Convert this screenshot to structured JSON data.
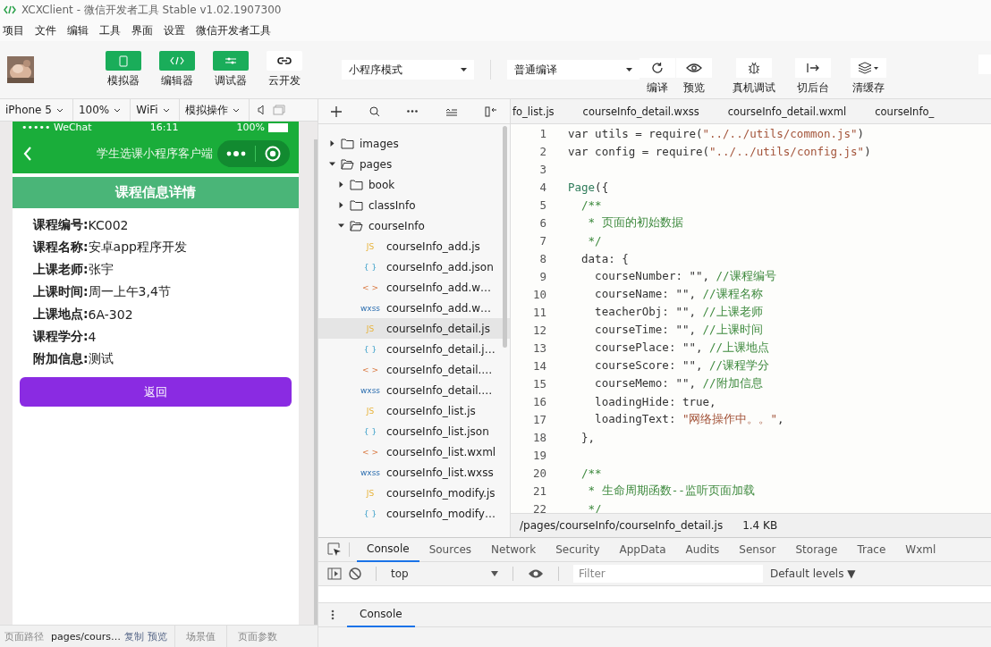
{
  "window": {
    "title": "XCXClient - 微信开发者工具 Stable v1.02.1907300"
  },
  "menu": [
    "项目",
    "文件",
    "编辑",
    "工具",
    "界面",
    "设置",
    "微信开发者工具"
  ],
  "toolbar": {
    "mode_buttons": [
      {
        "label": "模拟器",
        "on": true
      },
      {
        "label": "编辑器",
        "on": true
      },
      {
        "label": "调试器",
        "on": true
      },
      {
        "label": "云开发",
        "on": false
      }
    ],
    "mode_select": "小程序模式",
    "compile_select": "普通编译",
    "actions": [
      "编译",
      "预览",
      "真机调试",
      "切后台",
      "清缓存"
    ]
  },
  "simulator": {
    "device_bar": [
      "iPhone 5",
      "100%",
      "WiFi",
      "模拟操作"
    ],
    "status": {
      "carrier": "••••• WeChat",
      "time": "16:11",
      "battery": "100%"
    },
    "nav_title": "学生选课小程序客户端",
    "header": "课程信息详情",
    "fields": [
      {
        "label": "课程编号:",
        "value": "KC002"
      },
      {
        "label": "课程名称:",
        "value": "安卓app程序开发"
      },
      {
        "label": "上课老师:",
        "value": "张宇"
      },
      {
        "label": "上课时间:",
        "value": "周一上午3,4节"
      },
      {
        "label": "上课地点:",
        "value": "6A-302"
      },
      {
        "label": "课程学分:",
        "value": "4"
      },
      {
        "label": "附加信息:",
        "value": "测试"
      }
    ],
    "button": "返回"
  },
  "bottom_bar": {
    "label": "页面路径",
    "path": "pages/cours…",
    "links": [
      "复制",
      "预览"
    ],
    "scene": "场景值",
    "params": "页面参数"
  },
  "file_tree": [
    {
      "name": "images",
      "kind": "folder",
      "expanded": false,
      "selected": false
    },
    {
      "name": "pages",
      "kind": "folder",
      "expanded": true,
      "selected": false,
      "children": [
        {
          "name": "book",
          "kind": "folder",
          "expanded": false,
          "selected": false
        },
        {
          "name": "classInfo",
          "kind": "folder",
          "expanded": false,
          "selected": false
        },
        {
          "name": "courseInfo",
          "kind": "folder",
          "expanded": true,
          "selected": false,
          "children": [
            {
              "name": "courseInfo_add.js",
              "kind": "js",
              "badge": "JS",
              "selected": false
            },
            {
              "name": "courseInfo_add.json",
              "kind": "json",
              "badge": "{ }",
              "selected": false
            },
            {
              "name": "courseInfo_add.w…",
              "kind": "wxml",
              "badge": "< >",
              "selected": false
            },
            {
              "name": "courseInfo_add.w…",
              "kind": "wxss",
              "badge": "wxss",
              "selected": false
            },
            {
              "name": "courseInfo_detail.js",
              "kind": "js",
              "badge": "JS",
              "selected": true
            },
            {
              "name": "courseInfo_detail.j…",
              "kind": "json",
              "badge": "{ }",
              "selected": false
            },
            {
              "name": "courseInfo_detail.…",
              "kind": "wxml",
              "badge": "< >",
              "selected": false
            },
            {
              "name": "courseInfo_detail.…",
              "kind": "wxss",
              "badge": "wxss",
              "selected": false
            },
            {
              "name": "courseInfo_list.js",
              "kind": "js",
              "badge": "JS",
              "selected": false
            },
            {
              "name": "courseInfo_list.json",
              "kind": "json",
              "badge": "{ }",
              "selected": false
            },
            {
              "name": "courseInfo_list.wxml",
              "kind": "wxml",
              "badge": "< >",
              "selected": false
            },
            {
              "name": "courseInfo_list.wxss",
              "kind": "wxss",
              "badge": "wxss",
              "selected": false
            },
            {
              "name": "courseInfo_modify.js",
              "kind": "js",
              "badge": "JS",
              "selected": false
            },
            {
              "name": "courseInfo_modify…",
              "kind": "json",
              "badge": "{ }",
              "selected": false
            }
          ]
        }
      ]
    }
  ],
  "editor": {
    "tabs": [
      {
        "label": "fo_list.js",
        "selected": false
      },
      {
        "label": "courseInfo_detail.wxss",
        "selected": false
      },
      {
        "label": "courseInfo_detail.wxml",
        "selected": false
      },
      {
        "label": "courseInfo_",
        "selected": false
      }
    ],
    "lines": [
      {
        "number": "1",
        "segments": [
          {
            "text": "var utils = require(",
            "kind": "plain"
          },
          {
            "text": "\"../../utils/common.js\"",
            "kind": "string"
          },
          {
            "text": ")",
            "kind": "plain"
          }
        ]
      },
      {
        "number": "2",
        "segments": [
          {
            "text": "var config = require(",
            "kind": "plain"
          },
          {
            "text": "\"../../utils/config.js\"",
            "kind": "string"
          },
          {
            "text": ")",
            "kind": "plain"
          }
        ]
      },
      {
        "number": "3"
      },
      {
        "number": "4",
        "segments": [
          {
            "text": "Page",
            "kind": "keyword"
          },
          {
            "text": "({",
            "kind": "plain"
          }
        ]
      },
      {
        "number": "5",
        "segments": [
          {
            "text": "  /**",
            "kind": "comment"
          }
        ]
      },
      {
        "number": "6",
        "segments": [
          {
            "text": "   * 页面的初始数据",
            "kind": "comment"
          }
        ]
      },
      {
        "number": "7",
        "segments": [
          {
            "text": "   */",
            "kind": "comment"
          }
        ]
      },
      {
        "number": "8",
        "segments": [
          {
            "text": "  data: {",
            "kind": "plain"
          }
        ]
      },
      {
        "number": "9",
        "segments": [
          {
            "text": "    courseNumber: \"\", ",
            "kind": "plain"
          },
          {
            "text": "//课程编号",
            "kind": "comment"
          }
        ]
      },
      {
        "number": "10",
        "segments": [
          {
            "text": "    courseName: \"\", ",
            "kind": "plain"
          },
          {
            "text": "//课程名称",
            "kind": "comment"
          }
        ]
      },
      {
        "number": "11",
        "segments": [
          {
            "text": "    teacherObj: \"\", ",
            "kind": "plain"
          },
          {
            "text": "//上课老师",
            "kind": "comment"
          }
        ]
      },
      {
        "number": "12",
        "segments": [
          {
            "text": "    courseTime: \"\", ",
            "kind": "plain"
          },
          {
            "text": "//上课时间",
            "kind": "comment"
          }
        ]
      },
      {
        "number": "13",
        "segments": [
          {
            "text": "    coursePlace: \"\", ",
            "kind": "plain"
          },
          {
            "text": "//上课地点",
            "kind": "comment"
          }
        ]
      },
      {
        "number": "14",
        "segments": [
          {
            "text": "    courseScore: \"\", ",
            "kind": "plain"
          },
          {
            "text": "//课程学分",
            "kind": "comment"
          }
        ]
      },
      {
        "number": "15",
        "segments": [
          {
            "text": "    courseMemo: \"\", ",
            "kind": "plain"
          },
          {
            "text": "//附加信息",
            "kind": "comment"
          }
        ]
      },
      {
        "number": "16",
        "segments": [
          {
            "text": "    loadingHide: true,",
            "kind": "plain"
          }
        ]
      },
      {
        "number": "17",
        "segments": [
          {
            "text": "    loadingText: ",
            "kind": "plain"
          },
          {
            "text": "\"网络操作中。。\"",
            "kind": "string"
          },
          {
            "text": ",",
            "kind": "plain"
          }
        ]
      },
      {
        "number": "18",
        "segments": [
          {
            "text": "  },",
            "kind": "plain"
          }
        ]
      },
      {
        "number": "19"
      },
      {
        "number": "20",
        "segments": [
          {
            "text": "  /**",
            "kind": "comment"
          }
        ]
      },
      {
        "number": "21",
        "segments": [
          {
            "text": "   * 生命周期函数--监听页面加载",
            "kind": "comment"
          }
        ]
      },
      {
        "number": "22",
        "segments": [
          {
            "text": "   */",
            "kind": "comment"
          }
        ]
      }
    ],
    "file_path": "/pages/courseInfo/courseInfo_detail.js",
    "file_size": "1.4 KB"
  },
  "devtools": {
    "tabs": [
      {
        "label": "Console",
        "selected": true
      },
      {
        "label": "Sources",
        "selected": false
      },
      {
        "label": "Network",
        "selected": false
      },
      {
        "label": "Security",
        "selected": false
      },
      {
        "label": "AppData",
        "selected": false
      },
      {
        "label": "Audits",
        "selected": false
      },
      {
        "label": "Sensor",
        "selected": false
      },
      {
        "label": "Storage",
        "selected": false
      },
      {
        "label": "Trace",
        "selected": false
      },
      {
        "label": "Wxml",
        "selected": false
      }
    ],
    "context": "top",
    "filter_placeholder": "Filter",
    "levels": "Default levels ▼",
    "drawer_tab": "Console"
  }
}
